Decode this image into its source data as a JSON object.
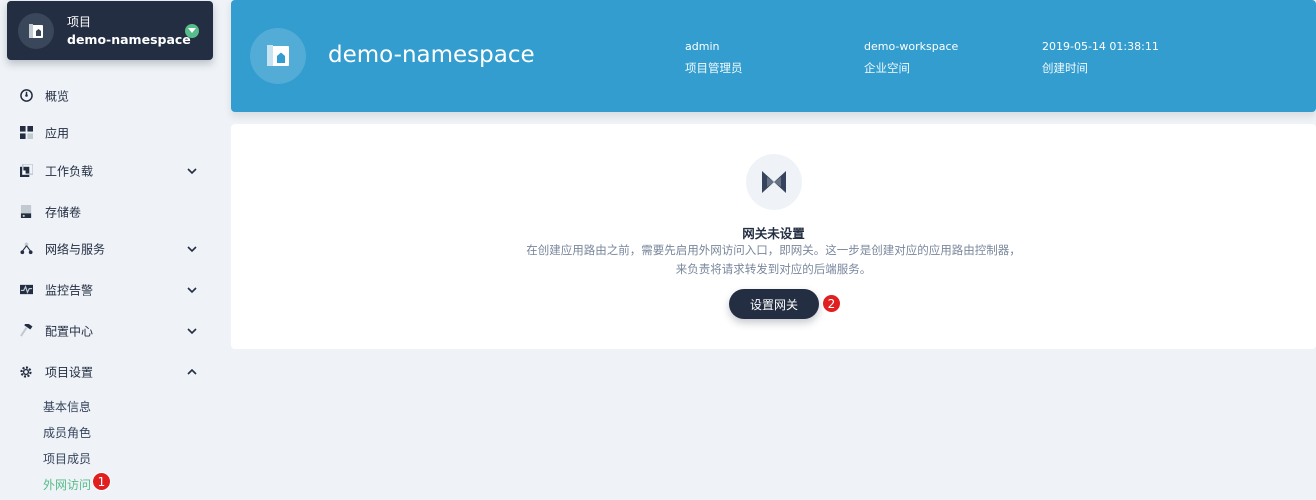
{
  "project_card": {
    "label": "项目",
    "name": "demo-namespace"
  },
  "sidebar": {
    "items": [
      {
        "label": "概览",
        "icon": "dashboard-icon"
      },
      {
        "label": "应用",
        "icon": "apps-icon"
      },
      {
        "label": "工作负载",
        "icon": "workload-icon"
      },
      {
        "label": "存储卷",
        "icon": "storage-icon"
      },
      {
        "label": "网络与服务",
        "icon": "network-icon"
      },
      {
        "label": "监控告警",
        "icon": "monitor-icon"
      },
      {
        "label": "配置中心",
        "icon": "hammer-icon"
      },
      {
        "label": "项目设置",
        "icon": "gear-icon"
      }
    ],
    "sub_items": [
      "基本信息",
      "成员角色",
      "项目成员",
      "外网访问"
    ]
  },
  "badges": [
    "1",
    "2"
  ],
  "header": {
    "title": "demo-namespace",
    "meta": [
      {
        "value": "admin",
        "key": "项目管理员"
      },
      {
        "value": "demo-workspace",
        "key": "企业空间"
      },
      {
        "value": "2019-05-14 01:38:11",
        "key": "创建时间"
      }
    ]
  },
  "empty_state": {
    "title": "网关未设置",
    "desc_line1": "在创建应用路由之前，需要先启用外网访问入口，即网关。这一步是创建对应的应用路由控制器，",
    "desc_line2": "来负责将请求转发到对应的后端服务。",
    "button": "设置网关"
  },
  "colors": {
    "banner": "#329dce",
    "dark": "#242e42",
    "active": "#55bc8a",
    "badge": "#e02020"
  }
}
